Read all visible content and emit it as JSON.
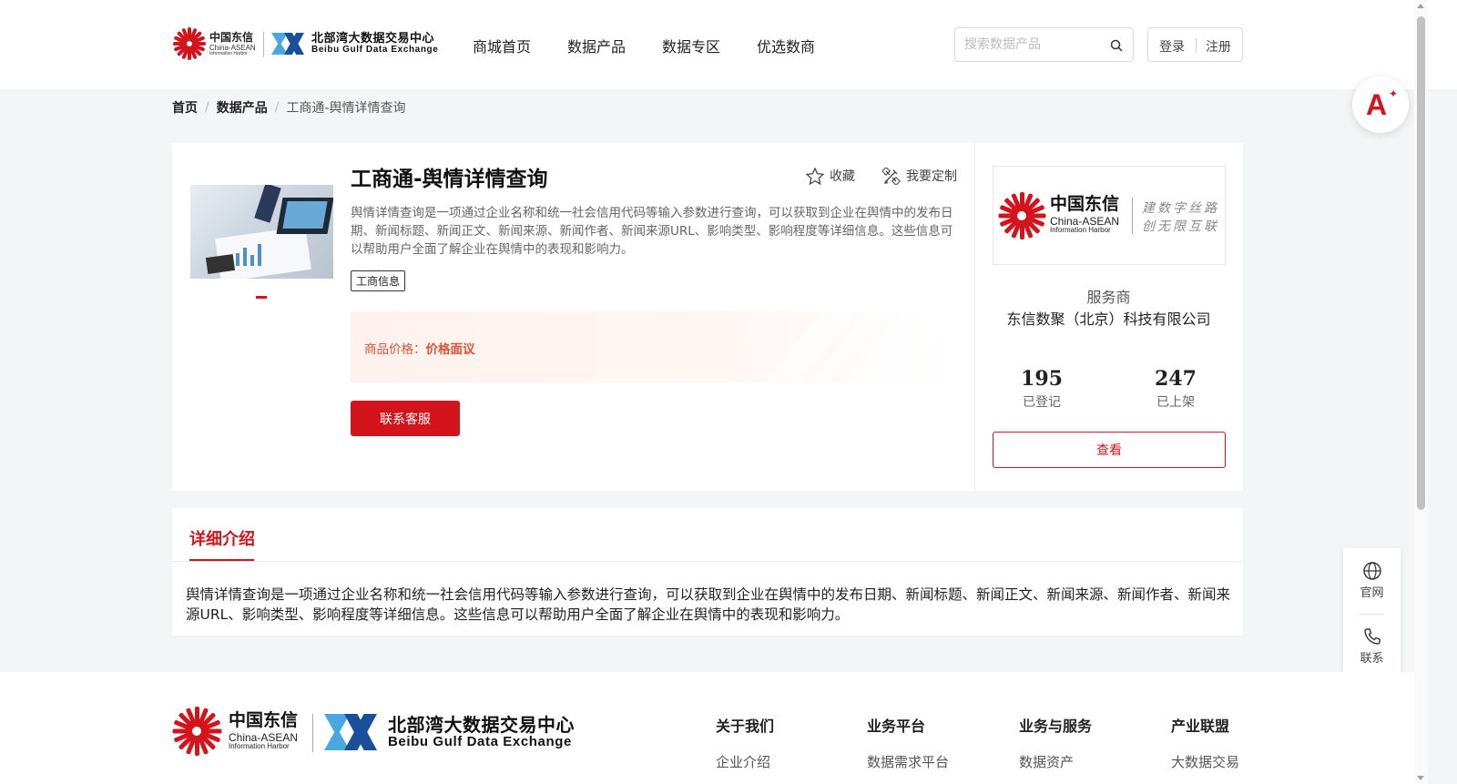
{
  "header": {
    "logo_cn": {
      "title": "中国东信",
      "sub1": "China-ASEAN",
      "sub2": "Information Harbor"
    },
    "logo_bb": {
      "title": "北部湾大数据交易中心",
      "sub": "Beibu Gulf Data Exchange"
    },
    "nav": [
      "商城首页",
      "数据产品",
      "数据专区",
      "优选数商"
    ],
    "search_placeholder": "搜索数据产品",
    "login": "登录",
    "register": "注册"
  },
  "breadcrumb": {
    "home": "首页",
    "category": "数据产品",
    "current": "工商通-舆情详情查询"
  },
  "product": {
    "title": "工商通-舆情详情查询",
    "favorite": "收藏",
    "customize": "我要定制",
    "description": "舆情详情查询是一项通过企业名称和统一社会信用代码等输入参数进行查询，可以获取到企业在舆情中的发布日期、新闻标题、新闻正文、新闻来源、新闻作者、新闻来源URL、影响类型、影响程度等详细信息。这些信息可以帮助用户全面了解企业在舆情中的表现和影响力。",
    "tag": "工商信息",
    "price_label": "商品价格：",
    "price_value": "价格面议",
    "contact_button": "联系客服"
  },
  "provider": {
    "logo_cn": {
      "title": "中国东信",
      "sub1": "China-ASEAN",
      "sub2": "Information Harbor"
    },
    "slogan_line1": "建数字丝路",
    "slogan_line2": "创无限互联",
    "role": "服务商",
    "name": "东信数聚（北京）科技有限公司",
    "registered_count": "195",
    "registered_label": "已登记",
    "listed_count": "247",
    "listed_label": "已上架",
    "view_button": "查看"
  },
  "detail": {
    "tab": "详细介绍",
    "text": "舆情详情查询是一项通过企业名称和统一社会信用代码等输入参数进行查询，可以获取到企业在舆情中的发布日期、新闻标题、新闻正文、新闻来源、新闻作者、新闻来源URL、影响类型、影响程度等详细信息。这些信息可以帮助用户全面了解企业在舆情中的表现和影响力。"
  },
  "float_bar": {
    "official": "官网",
    "contact": "联系"
  },
  "footer": {
    "logo_cn": {
      "title": "中国东信",
      "sub1": "China-ASEAN",
      "sub2": "Information Harbor"
    },
    "logo_bb": {
      "title": "北部湾大数据交易中心",
      "sub": "Beibu Gulf Data Exchange"
    },
    "columns": [
      {
        "heading": "关于我们",
        "first_item": "企业介绍"
      },
      {
        "heading": "业务平台",
        "first_item": "数据需求平台"
      },
      {
        "heading": "业务与服务",
        "first_item": "数据资产"
      },
      {
        "heading": "产业联盟",
        "first_item": "大数据交易"
      }
    ]
  },
  "colors": {
    "brand_red": "#d4141c",
    "price_orange": "#e0553a"
  }
}
